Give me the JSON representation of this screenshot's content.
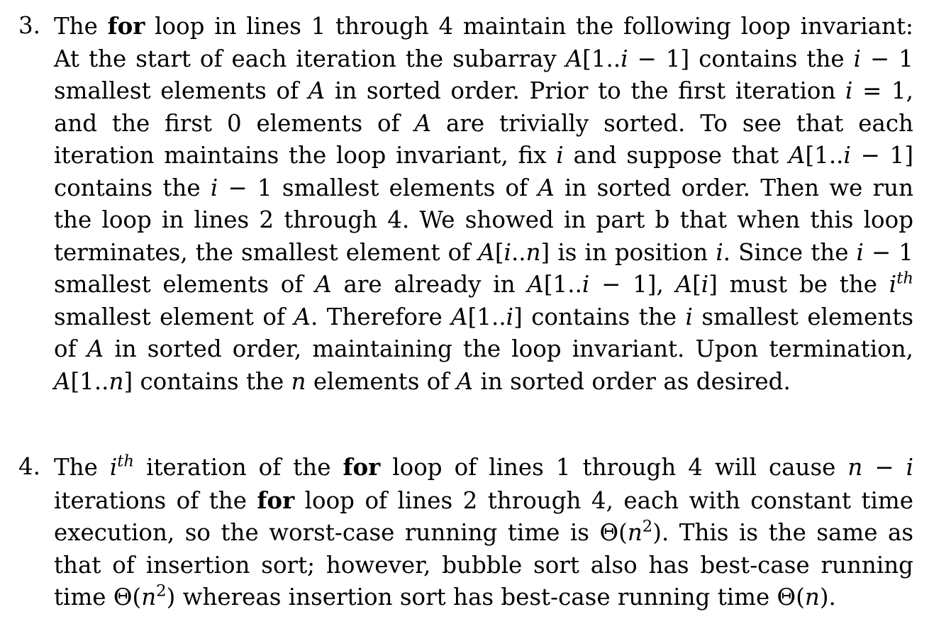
{
  "item3": {
    "number": "3.",
    "s1": "The",
    "for": "for",
    "s2": "loop in lines 1 through 4 maintain the following loop invariant: At the start of each iteration the subarray",
    "A": "A",
    "r1": "[1..",
    "i": "i",
    "r2": " − 1]",
    "s3": "contains the",
    "s4": "− 1 smallest elements of",
    "s5": "in sorted order. Prior to the first iteration",
    "eq": " = 1,",
    "s6": "and the first 0 elements of",
    "s7": "are trivially sorted. To see that each iteration maintains the loop invariant, fix",
    "s8": "and suppose that",
    "s9": "contains the",
    "s10": "− 1 smallest elements of",
    "s11": "in sorted order. Then we run the loop in lines 2 through 4. We showed in part b that when this loop terminates, the smallest element of",
    "n": "n",
    "r3": "..",
    "r4": "]",
    "s12": "is in position",
    "s13": ". Since the",
    "s14": "− 1 smallest elements of",
    "s15": "are already in",
    "s16": ",",
    "s17": "must be the",
    "th": "th",
    "s18": "smallest element of",
    "s19": ". Therefore",
    "s20": "contains the",
    "s21": "smallest elements of",
    "s22": "in sorted order, maintaining the loop invariant. Upon termination,",
    "s23": "contains the",
    "s24": "elements of",
    "s25": "in sorted order as desired."
  },
  "item4": {
    "number": "4.",
    "s1": "The",
    "i": "i",
    "th": "th",
    "s2": "iteration of the",
    "for": "for",
    "s3": "loop of lines 1 through 4 will cause",
    "n": "n",
    "minus": " − ",
    "s4": "iterations of the",
    "s5": "loop of lines 2 through 4, each with constant time execution, so the worst-case running time is",
    "theta": "Θ(",
    "sq": "2",
    "close": ")",
    "s6": ". This is the same as that of insertion sort; however, bubble sort also has best-case running time",
    "s7": "whereas insertion sort has best-case running time",
    "s8": "."
  }
}
